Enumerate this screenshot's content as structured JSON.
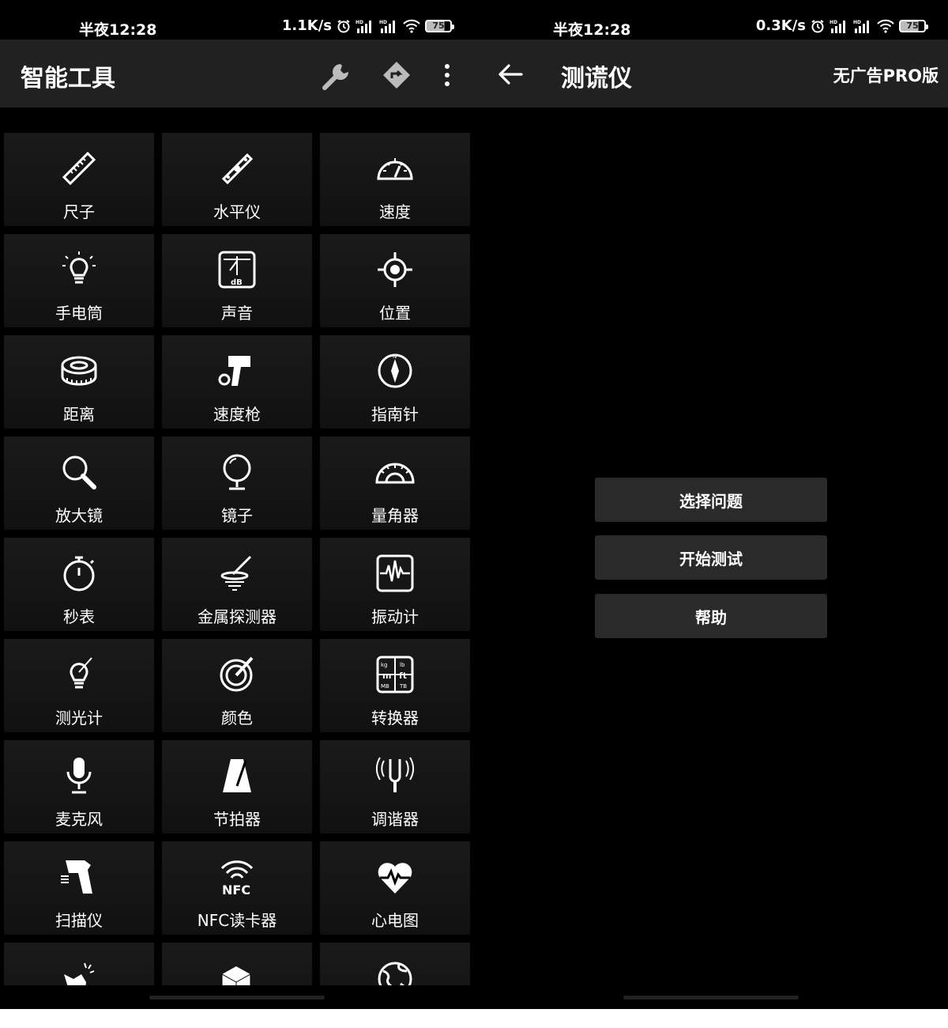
{
  "left": {
    "status": {
      "time": "半夜12:28",
      "speed": "1.1K/s",
      "battery": "75"
    },
    "appbar": {
      "title": "智能工具"
    },
    "tools": [
      {
        "label": "尺子",
        "icon": "ruler-icon"
      },
      {
        "label": "水平仪",
        "icon": "level-icon"
      },
      {
        "label": "速度",
        "icon": "speedometer-icon"
      },
      {
        "label": "手电筒",
        "icon": "flashlight-icon"
      },
      {
        "label": "声音",
        "icon": "decibel-meter-icon"
      },
      {
        "label": "位置",
        "icon": "location-icon"
      },
      {
        "label": "距离",
        "icon": "tape-measure-icon"
      },
      {
        "label": "速度枪",
        "icon": "speed-gun-icon"
      },
      {
        "label": "指南针",
        "icon": "compass-icon"
      },
      {
        "label": "放大镜",
        "icon": "magnifier-icon"
      },
      {
        "label": "镜子",
        "icon": "mirror-icon"
      },
      {
        "label": "量角器",
        "icon": "protractor-icon"
      },
      {
        "label": "秒表",
        "icon": "stopwatch-icon"
      },
      {
        "label": "金属探测器",
        "icon": "metal-detector-icon"
      },
      {
        "label": "振动计",
        "icon": "vibrometer-icon"
      },
      {
        "label": "测光计",
        "icon": "light-meter-icon"
      },
      {
        "label": "颜色",
        "icon": "color-icon"
      },
      {
        "label": "转换器",
        "icon": "converter-icon"
      },
      {
        "label": "麦克风",
        "icon": "microphone-icon"
      },
      {
        "label": "节拍器",
        "icon": "metronome-icon"
      },
      {
        "label": "调谐器",
        "icon": "tuner-icon"
      },
      {
        "label": "扫描仪",
        "icon": "scanner-icon"
      },
      {
        "label": "NFC读卡器",
        "icon": "nfc-icon"
      },
      {
        "label": "心电图",
        "icon": "heart-rate-icon"
      },
      {
        "label": "",
        "icon": "hand-icon"
      },
      {
        "label": "",
        "icon": "dice-icon"
      },
      {
        "label": "",
        "icon": "globe-icon"
      }
    ]
  },
  "right": {
    "status": {
      "time": "半夜12:28",
      "speed": "0.3K/s",
      "battery": "75"
    },
    "appbar": {
      "title": "测谎仪",
      "pro": "无广告PRO版"
    },
    "buttons": [
      {
        "label": "选择问题"
      },
      {
        "label": "开始测试"
      },
      {
        "label": "帮助"
      }
    ]
  },
  "colors": {
    "background": "#000000",
    "appbar": "#212121",
    "tile": "#161616",
    "button": "#2a2a2a"
  }
}
